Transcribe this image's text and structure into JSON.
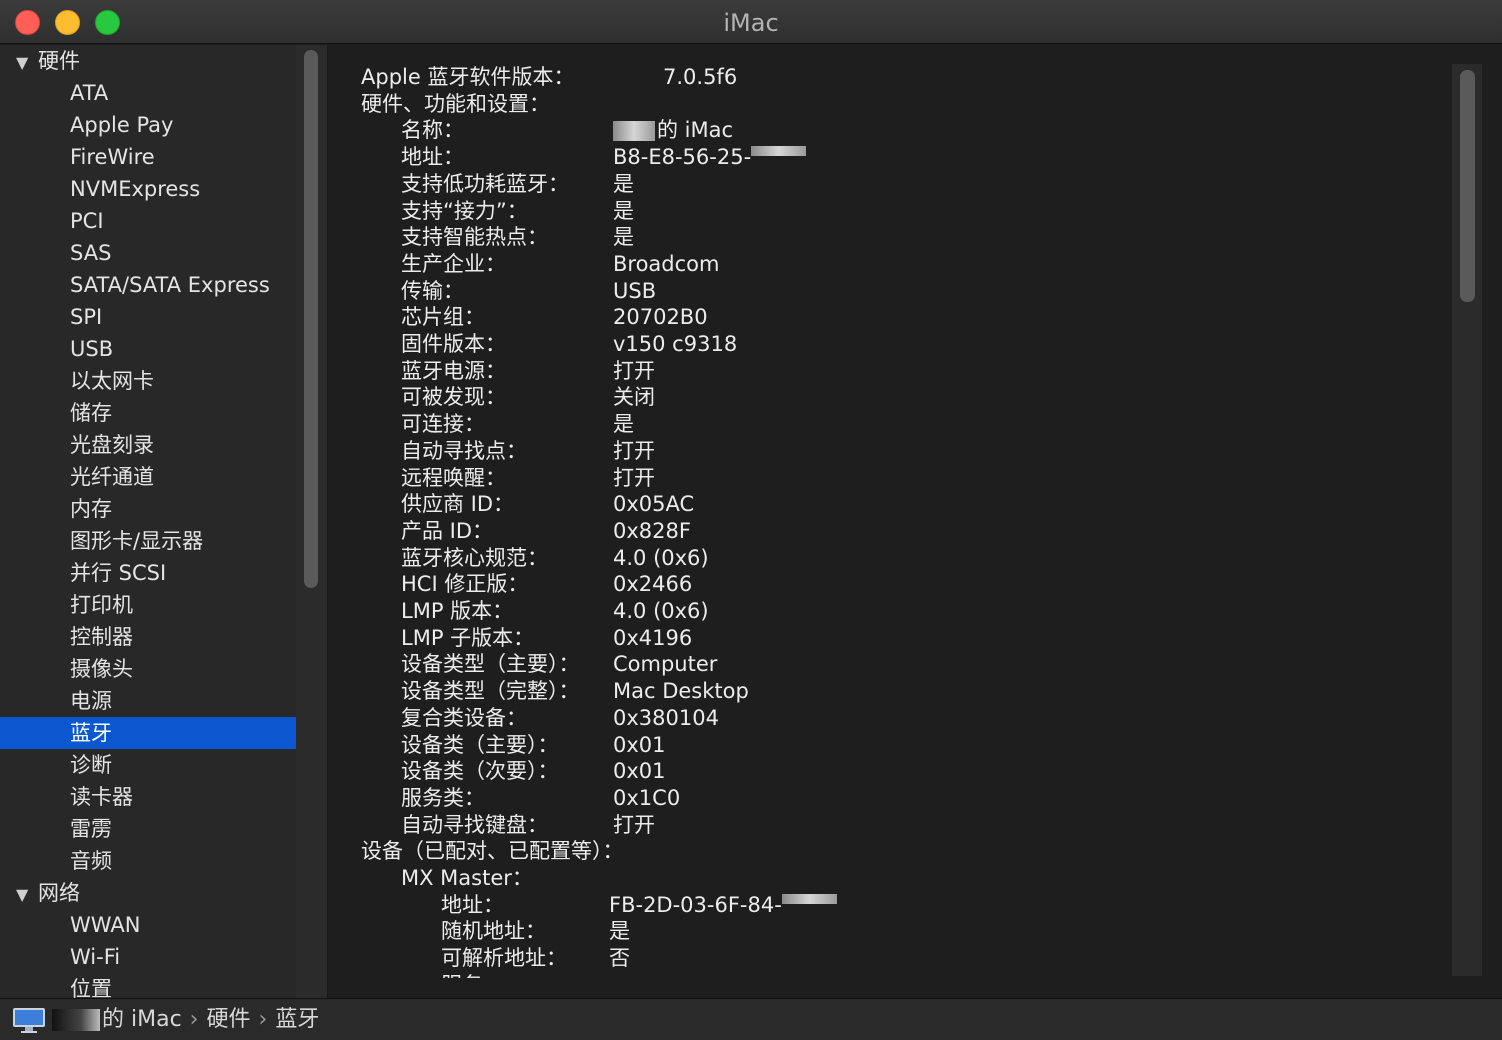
{
  "window": {
    "title": "iMac"
  },
  "sidebar": {
    "groups": [
      {
        "label": "硬件",
        "expanded": true,
        "items": [
          "ATA",
          "Apple Pay",
          "FireWire",
          "NVMExpress",
          "PCI",
          "SAS",
          "SATA/SATA Express",
          "SPI",
          "USB",
          "以太网卡",
          "储存",
          "光盘刻录",
          "光纤通道",
          "内存",
          "图形卡/显示器",
          "并行 SCSI",
          "打印机",
          "控制器",
          "摄像头",
          "电源",
          "蓝牙",
          "诊断",
          "读卡器",
          "雷雳",
          "音频"
        ]
      },
      {
        "label": "网络",
        "expanded": true,
        "items": [
          "WWAN",
          "Wi-Fi",
          "位置"
        ]
      }
    ],
    "selected": "蓝牙"
  },
  "content": {
    "lines": [
      {
        "indent": 0,
        "label": "Apple 蓝牙软件版本：",
        "value": "7.0.5f6"
      },
      {
        "indent": 0,
        "label": "硬件、功能和设置：",
        "value": ""
      },
      {
        "indent": 1,
        "label": "名称：",
        "value": "的 iMac",
        "redact_prefix": true
      },
      {
        "indent": 1,
        "label": "地址：",
        "value": "B8-E8-56-25-",
        "redact_suffix": true
      },
      {
        "indent": 1,
        "label": "支持低功耗蓝牙：",
        "value": "是"
      },
      {
        "indent": 1,
        "label": "支持“接力”：",
        "value": "是"
      },
      {
        "indent": 1,
        "label": "支持智能热点：",
        "value": "是"
      },
      {
        "indent": 1,
        "label": "生产企业：",
        "value": "Broadcom"
      },
      {
        "indent": 1,
        "label": "传输：",
        "value": "USB"
      },
      {
        "indent": 1,
        "label": "芯片组：",
        "value": "20702B0"
      },
      {
        "indent": 1,
        "label": "固件版本：",
        "value": "v150 c9318"
      },
      {
        "indent": 1,
        "label": "蓝牙电源：",
        "value": "打开"
      },
      {
        "indent": 1,
        "label": "可被发现：",
        "value": "关闭"
      },
      {
        "indent": 1,
        "label": "可连接：",
        "value": "是"
      },
      {
        "indent": 1,
        "label": "自动寻找点：",
        "value": "打开"
      },
      {
        "indent": 1,
        "label": "远程唤醒：",
        "value": "打开"
      },
      {
        "indent": 1,
        "label": "供应商 ID：",
        "value": "0x05AC"
      },
      {
        "indent": 1,
        "label": "产品 ID：",
        "value": "0x828F"
      },
      {
        "indent": 1,
        "label": "蓝牙核心规范：",
        "value": "4.0 (0x6)"
      },
      {
        "indent": 1,
        "label": "HCI 修正版：",
        "value": "0x2466"
      },
      {
        "indent": 1,
        "label": "LMP 版本：",
        "value": "4.0 (0x6)"
      },
      {
        "indent": 1,
        "label": "LMP 子版本：",
        "value": "0x4196"
      },
      {
        "indent": 1,
        "label": "设备类型（主要）：",
        "value": "Computer"
      },
      {
        "indent": 1,
        "label": "设备类型（完整）：",
        "value": "Mac Desktop"
      },
      {
        "indent": 1,
        "label": "复合类设备：",
        "value": "0x380104"
      },
      {
        "indent": 1,
        "label": "设备类（主要）：",
        "value": "0x01"
      },
      {
        "indent": 1,
        "label": "设备类（次要）：",
        "value": "0x01"
      },
      {
        "indent": 1,
        "label": "服务类：",
        "value": "0x1C0"
      },
      {
        "indent": 1,
        "label": "自动寻找键盘：",
        "value": "打开"
      },
      {
        "indent": 0,
        "label": "设备（已配对、已配置等）：",
        "value": ""
      },
      {
        "indent": 1,
        "label": "MX Master：",
        "value": ""
      },
      {
        "indent": 2,
        "label": "地址：",
        "value": "FB-2D-03-6F-84-",
        "redact_suffix": true
      },
      {
        "indent": 2,
        "label": "随机地址：",
        "value": "是"
      },
      {
        "indent": 2,
        "label": "可解析地址：",
        "value": "否"
      },
      {
        "indent": 2,
        "label": "服务：",
        "value": ""
      }
    ]
  },
  "pathbar": {
    "computer": "的 iMac",
    "section": "硬件",
    "selected": "蓝牙",
    "separator": "›"
  }
}
